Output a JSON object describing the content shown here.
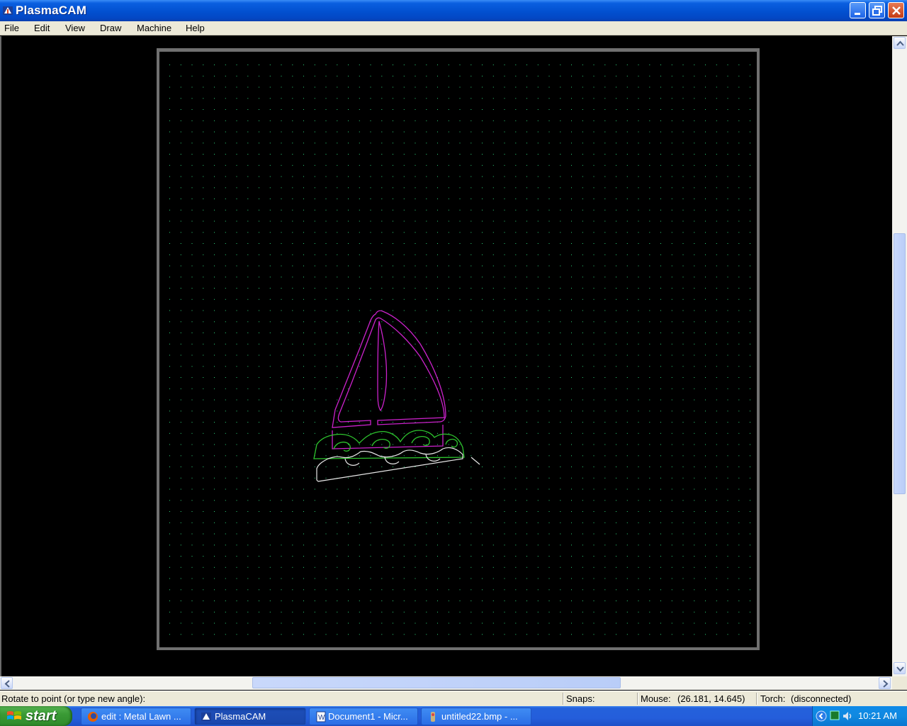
{
  "window": {
    "title": "PlasmaCAM",
    "icons": {
      "app": "plasmacam-app-icon",
      "minimize": "minimize-icon",
      "maximize": "restore-icon",
      "close": "close-icon"
    }
  },
  "menu": {
    "items": [
      "File",
      "Edit",
      "View",
      "Draw",
      "Machine",
      "Help"
    ]
  },
  "canvas": {
    "background": "#000000",
    "grid_dot_color": "#2ed27a",
    "table_border_color": "#707070",
    "colors": {
      "sail": "#cc22cc",
      "waves": "#2ec52e",
      "hull": "#e8e8e8"
    }
  },
  "statusbar": {
    "prompt": "Rotate to point (or type new angle):",
    "snaps_label": "Snaps:",
    "mouse_label": "Mouse:",
    "mouse_coords": "(26.181, 14.645)",
    "torch_label": "Torch:",
    "torch_status": "(disconnected)"
  },
  "taskbar": {
    "start_label": "start",
    "tasks": [
      {
        "label": "edit : Metal Lawn ...",
        "icon": "firefox-icon",
        "active": false
      },
      {
        "label": "PlasmaCAM",
        "icon": "plasmacam-icon",
        "active": true
      },
      {
        "label": "Document1 - Micr...",
        "icon": "word-icon",
        "active": false
      },
      {
        "label": "untitled22.bmp - ...",
        "icon": "paint-icon",
        "active": false
      }
    ],
    "clock": "10:21 AM"
  }
}
